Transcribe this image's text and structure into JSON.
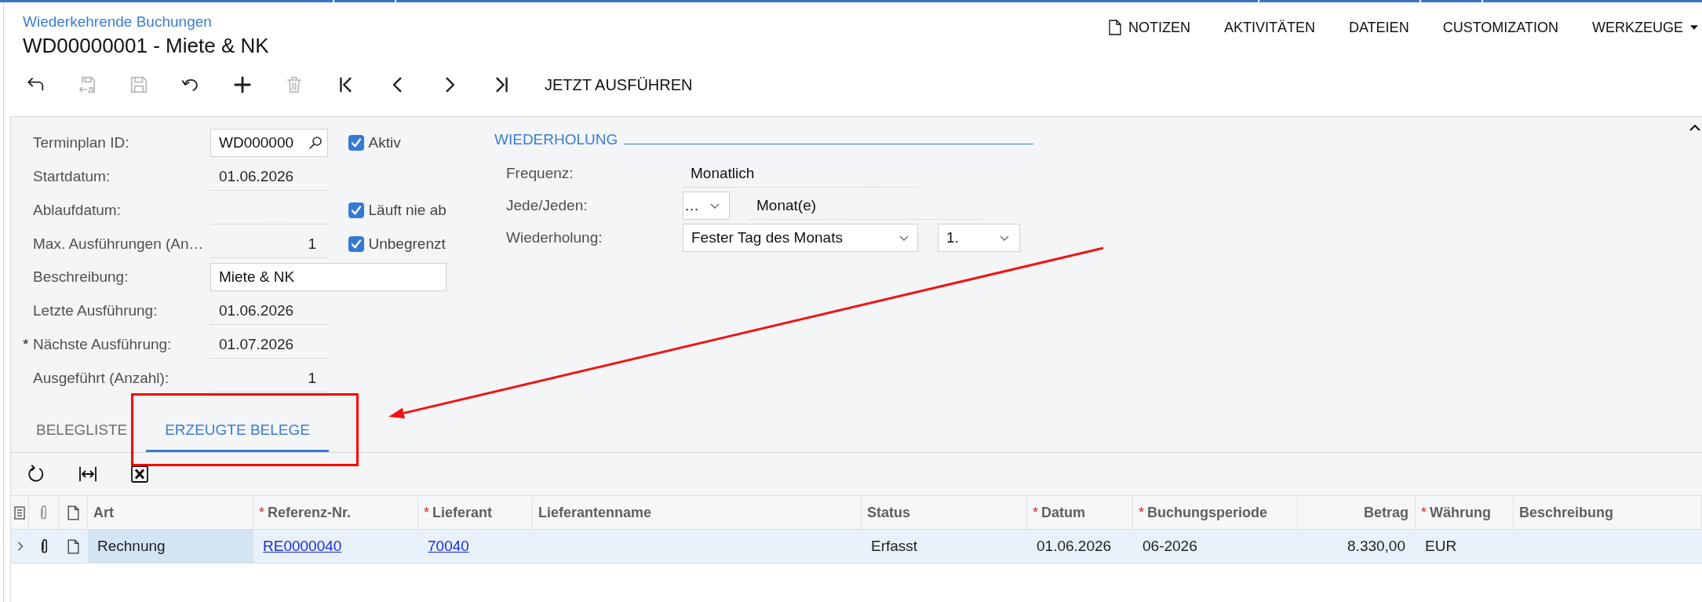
{
  "breadcrumb": "Wiederkehrende Buchungen",
  "title": "WD00000001 - Miete & NK",
  "top_menu": [
    {
      "label": "NOTIZEN",
      "kind": "notes"
    },
    {
      "label": "AKTIVITÄTEN",
      "kind": "plain"
    },
    {
      "label": "DATEIEN",
      "kind": "plain"
    },
    {
      "label": "CUSTOMIZATION",
      "kind": "plain"
    },
    {
      "label": "WERKZEUGE",
      "kind": "dropdown"
    }
  ],
  "toolbar": {
    "buttons": [
      {
        "kind": "back",
        "disabled": false
      },
      {
        "kind": "save_close",
        "disabled": true
      },
      {
        "kind": "save",
        "disabled": true
      },
      {
        "kind": "cancel",
        "disabled": false
      },
      {
        "kind": "add",
        "disabled": false
      },
      {
        "kind": "delete",
        "disabled": true
      },
      {
        "kind": "first",
        "disabled": false
      },
      {
        "kind": "previous",
        "disabled": false
      },
      {
        "kind": "next",
        "disabled": false
      },
      {
        "kind": "last",
        "disabled": false
      }
    ],
    "action": "JETZT AUSFÜHREN"
  },
  "form": {
    "fields": [
      {
        "label": "Terminplan ID:",
        "kind": "lookup",
        "value": "WD000000",
        "checkbox": {
          "label": "Aktiv",
          "checked": true
        }
      },
      {
        "label": "Startdatum:",
        "kind": "readonly",
        "value": "01.06.2026"
      },
      {
        "label": "Ablaufdatum:",
        "kind": "readonly",
        "checkbox": {
          "label": "Läuft nie ab",
          "checked": true
        }
      },
      {
        "label": "Max. Ausführungen (An…",
        "kind": "number",
        "value": "1",
        "checkbox": {
          "label": "Unbegrenzt",
          "checked": true
        }
      },
      {
        "label": "Beschreibung:",
        "kind": "input",
        "value": "Miete & NK"
      },
      {
        "label": "Letzte Ausführung:",
        "kind": "readonly",
        "value": "01.06.2026"
      },
      {
        "label": "Nächste Ausführung:",
        "kind": "readonly",
        "value": "01.07.2026",
        "marker": "*"
      },
      {
        "label": "Ausgeführt (Anzahl):",
        "kind": "number",
        "value": "1"
      }
    ],
    "recurrence": {
      "title": "WIEDERHOLUNG",
      "rows": [
        {
          "label": "Frequenz:",
          "controls": [
            {
              "kind": "readonly",
              "value": "Monatlich"
            }
          ]
        },
        {
          "label": "Jede/Jeden:",
          "controls": [
            {
              "kind": "dropdown",
              "value": "…"
            },
            {
              "kind": "readonly",
              "value": "Monat(e)"
            }
          ]
        },
        {
          "label": "Wiederholung:",
          "controls": [
            {
              "kind": "dropdown",
              "value": "Fester Tag des Monats"
            },
            {
              "kind": "dropdown",
              "value": "1."
            }
          ]
        }
      ]
    }
  },
  "tabs": [
    {
      "label": "BELEGLISTE",
      "selected": false
    },
    {
      "label": "ERZEUGTE BELEGE",
      "selected": true
    }
  ],
  "grid": {
    "columns": [
      {
        "label": "Art",
        "kind": "text"
      },
      {
        "label": "Referenz-Nr.",
        "kind": "text",
        "marker": "*"
      },
      {
        "label": "Lieferant",
        "kind": "text",
        "marker": "*"
      },
      {
        "label": "Lieferantenname",
        "kind": "text"
      },
      {
        "label": "Status",
        "kind": "text"
      },
      {
        "label": "Datum",
        "kind": "text",
        "marker": "*"
      },
      {
        "label": "Buchungsperiode",
        "kind": "text",
        "marker": "*"
      },
      {
        "label": "Betrag",
        "kind": "amount"
      },
      {
        "label": "Währung",
        "kind": "text",
        "marker": "*"
      },
      {
        "label": "Beschreibung",
        "kind": "text"
      }
    ],
    "rows": [
      {
        "selected": true,
        "cells": [
          {
            "text": "Rechnung",
            "kind": "text",
            "selected": true
          },
          {
            "text": "RE0000040",
            "kind": "link",
            "selected": false
          },
          {
            "text": "70040",
            "kind": "link",
            "selected": false
          },
          {
            "kind": "text",
            "selected": false
          },
          {
            "text": "Erfasst",
            "kind": "text",
            "selected": false
          },
          {
            "text": "01.06.2026",
            "kind": "text",
            "selected": false
          },
          {
            "text": "06-2026",
            "kind": "text",
            "selected": false
          },
          {
            "text": "8.330,00",
            "kind": "text",
            "selected": false
          },
          {
            "text": "EUR",
            "kind": "text",
            "selected": false
          },
          {
            "kind": "text",
            "selected": false
          }
        ]
      }
    ]
  },
  "annotations": {
    "frame": true,
    "arrow": true
  }
}
